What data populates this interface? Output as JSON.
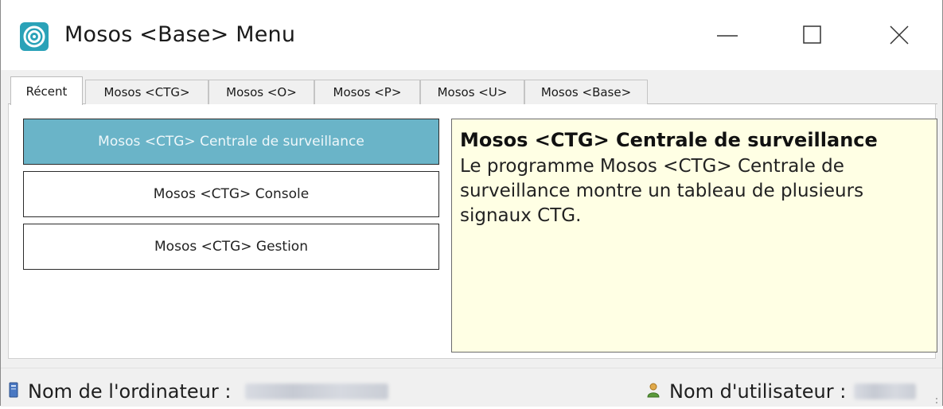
{
  "window": {
    "title": "Mosos <Base> Menu",
    "icon": "mosos-logo-icon",
    "controls": [
      "minimize-icon",
      "maximize-icon",
      "close-icon"
    ]
  },
  "tabs": [
    {
      "label": "Récent",
      "active": true
    },
    {
      "label": "Mosos <CTG>",
      "active": false
    },
    {
      "label": "Mosos <O>",
      "active": false
    },
    {
      "label": "Mosos <P>",
      "active": false
    },
    {
      "label": "Mosos <U>",
      "active": false
    },
    {
      "label": "Mosos <Base>",
      "active": false
    }
  ],
  "programs": [
    {
      "label": "Mosos <CTG> Centrale de surveillance",
      "selected": true
    },
    {
      "label": "Mosos <CTG> Console",
      "selected": false
    },
    {
      "label": "Mosos <CTG> Gestion",
      "selected": false
    }
  ],
  "description": {
    "title": "Mosos <CTG> Centrale de surveillance",
    "body": "Le programme Mosos <CTG> Centrale de surveillance montre un tableau de plusieurs signaux CTG."
  },
  "status": {
    "computer_label": "Nom de l'ordinateur :",
    "computer_icon": "computer-icon",
    "user_label": "Nom d'utilisateur :",
    "user_icon": "user-icon"
  },
  "colors": {
    "selected_button": "#6ab4c8",
    "description_background": "#ffffe4",
    "app_icon": "#2aa2b8"
  }
}
